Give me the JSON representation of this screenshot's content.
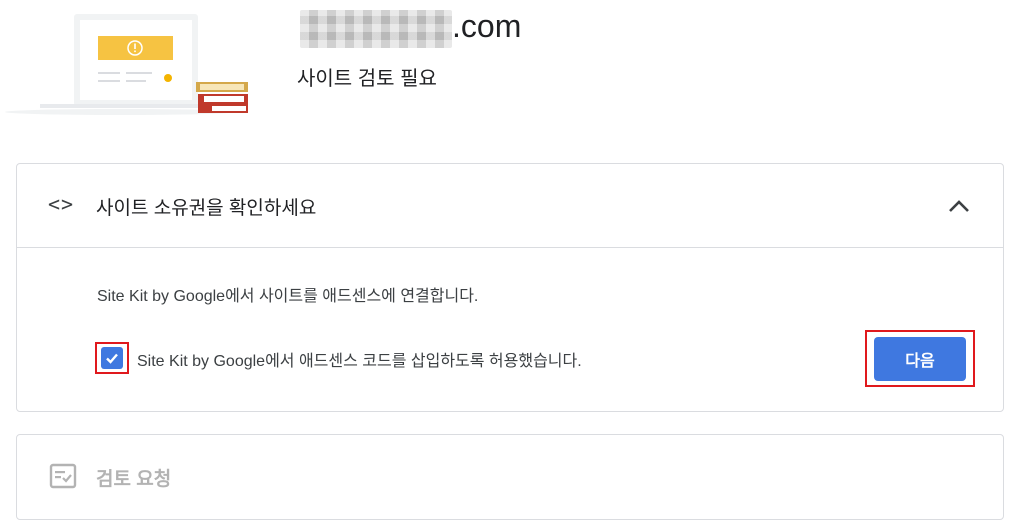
{
  "header": {
    "domain_suffix": ".com",
    "status": "사이트 검토 필요"
  },
  "step1": {
    "title": "사이트 소유권을 확인하세요",
    "description": "Site Kit by Google에서 사이트를 애드센스에 연결합니다.",
    "checkbox_label": "Site Kit by Google에서 애드센스 코드를 삽입하도록 허용했습니다.",
    "checkbox_checked": true,
    "next_label": "다음",
    "icon": "code-icon"
  },
  "step2": {
    "title": "검토 요청",
    "icon": "review-icon"
  },
  "colors": {
    "primary": "#3f78e0",
    "highlight": "#e0191d",
    "warning": "#f4b400",
    "disabled": "#b3b3b3"
  }
}
